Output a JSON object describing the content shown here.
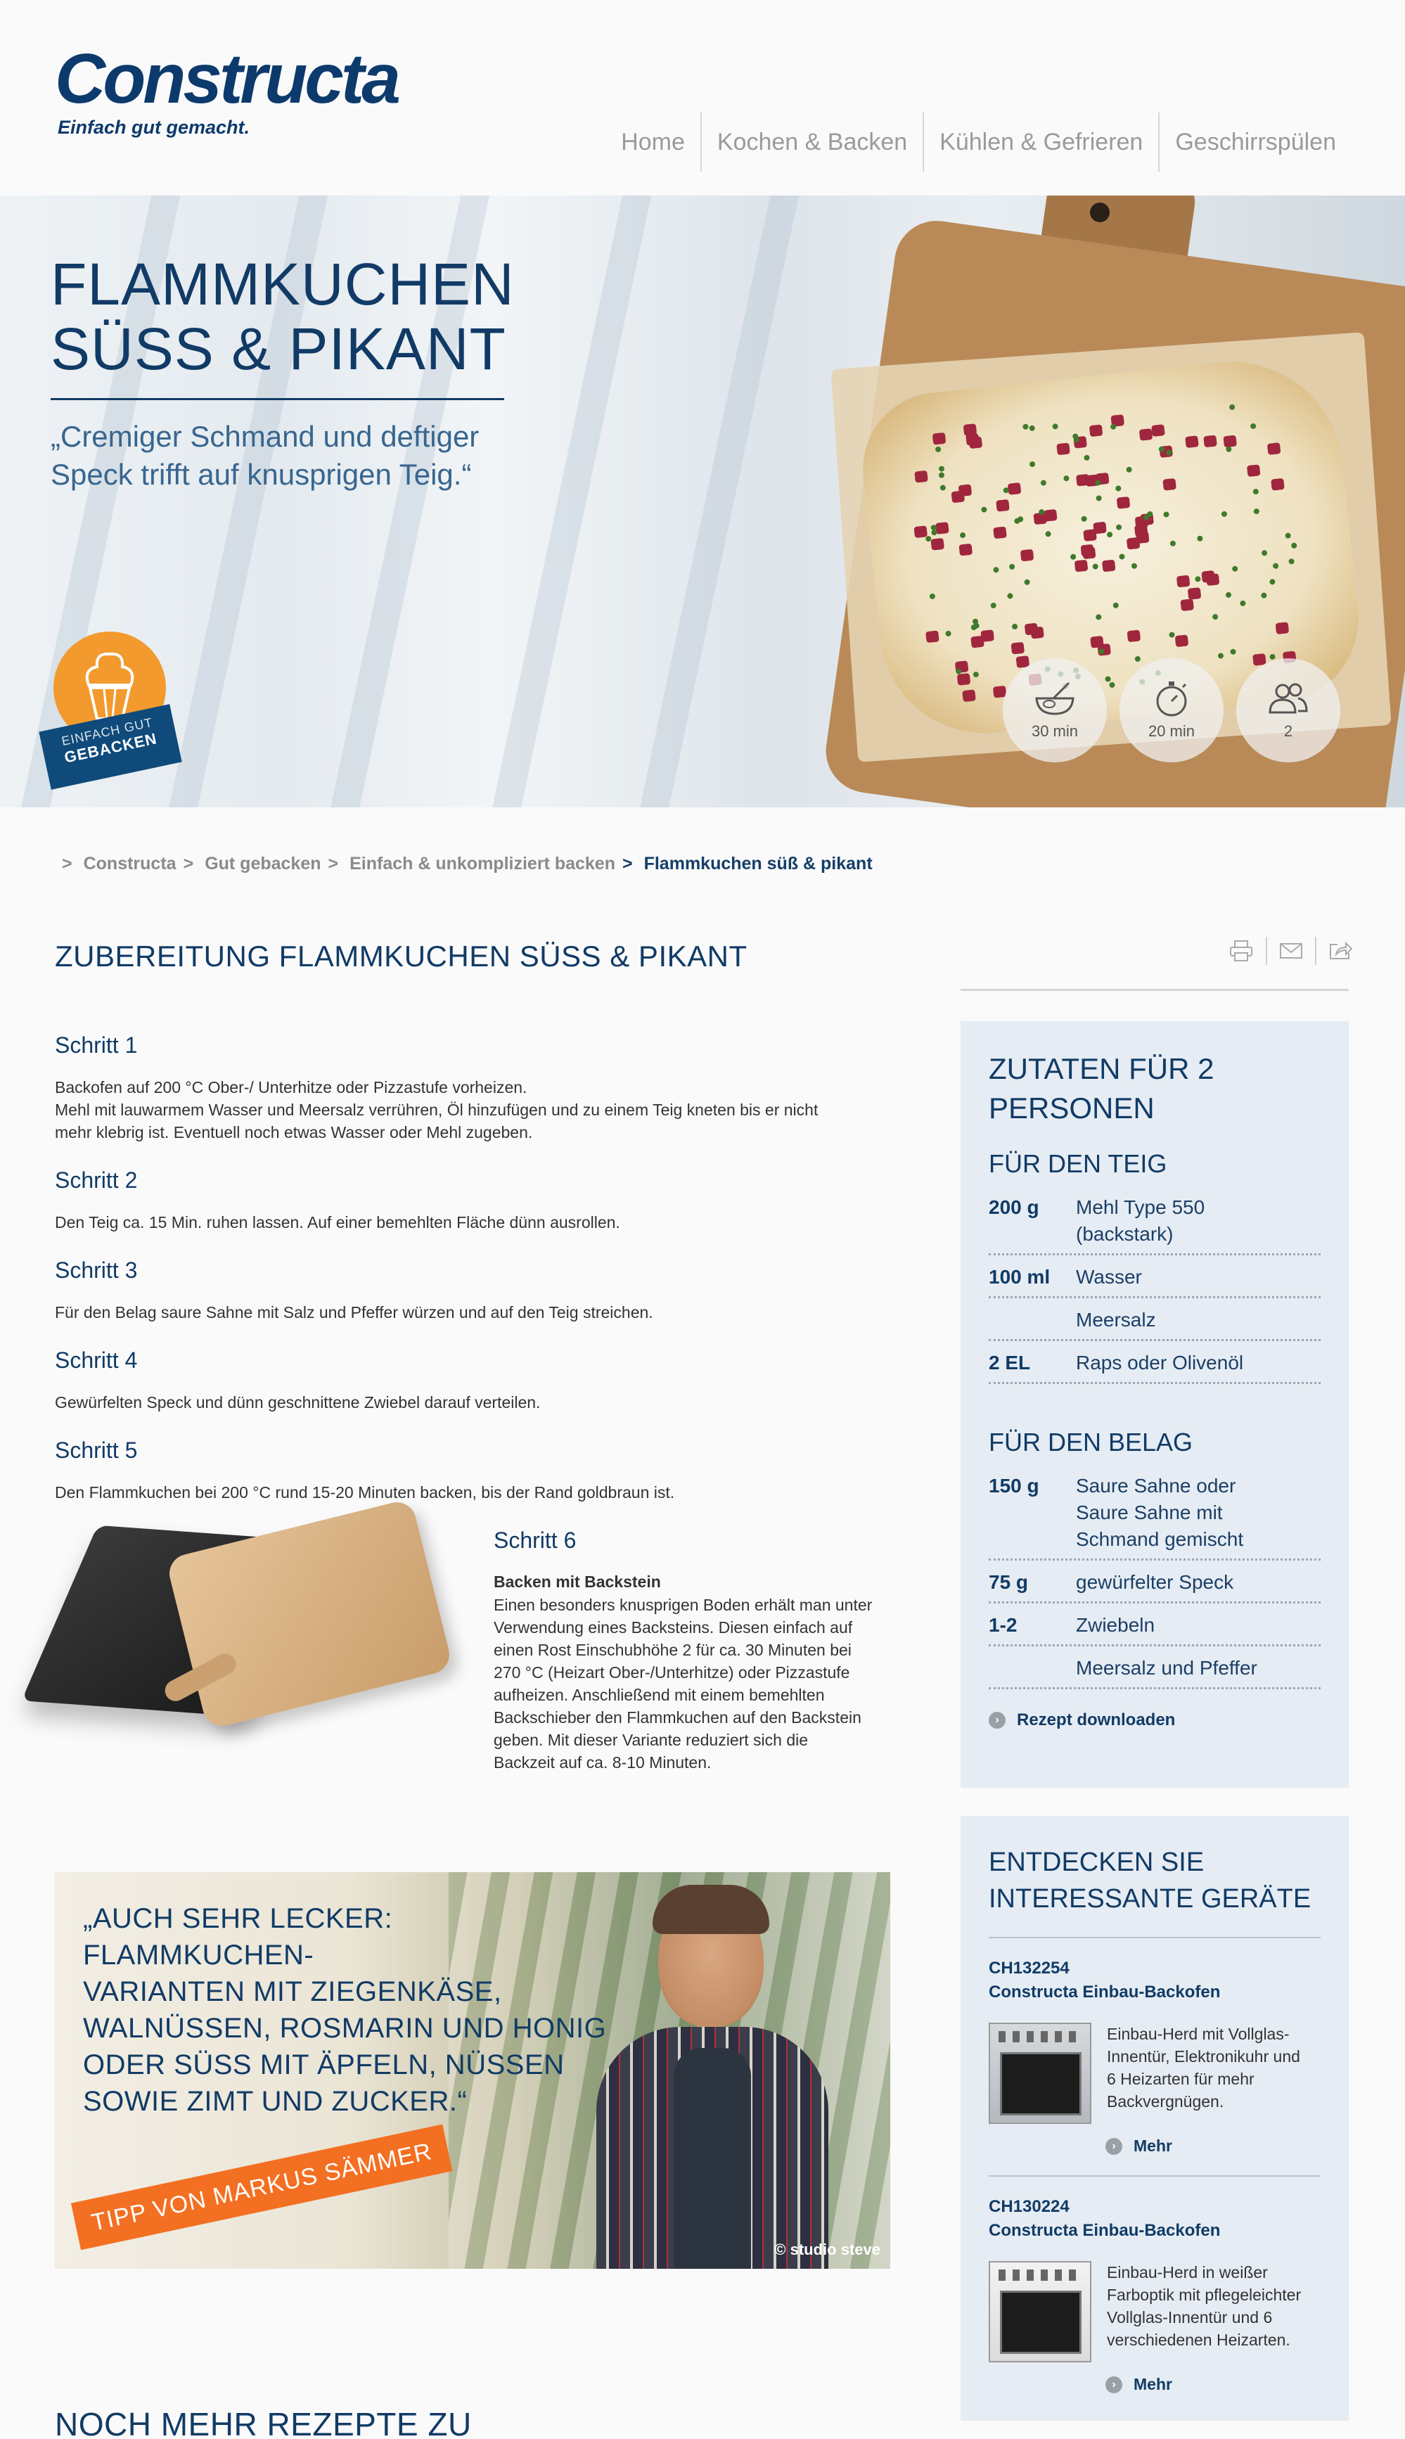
{
  "header": {
    "logo_word": "Constructa",
    "logo_tagline": "Einfach gut gemacht.",
    "nav": [
      "Home",
      "Kochen & Backen",
      "Kühlen & Gefrieren",
      "Geschirrspülen"
    ]
  },
  "hero": {
    "title_line1": "FLAMMKUCHEN",
    "title_line2": "SÜSS & PIKANT",
    "quote_line1": "„Cremiger Schmand und deftiger",
    "quote_line2": "Speck trifft auf knusprigen Teig.“",
    "badge_line1": "EINFACH GUT",
    "badge_line2": "GEBACKEN",
    "info": [
      {
        "icon": "bowl-whisk-icon",
        "label": "30 min"
      },
      {
        "icon": "stopwatch-icon",
        "label": "20 min"
      },
      {
        "icon": "people-icon",
        "label": "2"
      }
    ]
  },
  "breadcrumb": {
    "sep": ">",
    "items": [
      "Constructa",
      "Gut gebacken",
      "Einfach & unkompliziert backen"
    ],
    "current": "Flammkuchen süß & pikant"
  },
  "main": {
    "title": "ZUBEREITUNG FLAMMKUCHEN SÜSS & PIKANT",
    "steps": [
      {
        "title": "Schritt 1",
        "lines": [
          "Backofen auf 200 °C Ober-/ Unterhitze oder Pizzastufe vorheizen.",
          "Mehl mit lauwarmem Wasser und Meersalz verrühren, Öl hinzufügen und zu einem Teig kneten bis er nicht",
          "mehr klebrig ist. Eventuell noch etwas Wasser oder Mehl zugeben."
        ]
      },
      {
        "title": "Schritt 2",
        "lines": [
          "Den Teig ca. 15 Min. ruhen lassen. Auf einer bemehlten Fläche dünn ausrollen."
        ]
      },
      {
        "title": "Schritt 3",
        "lines": [
          "Für den Belag saure Sahne mit Salz und Pfeffer würzen und auf den Teig streichen."
        ]
      },
      {
        "title": "Schritt 4",
        "lines": [
          "Gewürfelten Speck und dünn geschnittene Zwiebel darauf verteilen."
        ]
      },
      {
        "title": "Schritt 5",
        "lines": [
          "Den Flammkuchen bei 200 °C rund 15-20 Minuten backen, bis der Rand goldbraun ist."
        ]
      }
    ],
    "step6": {
      "title": "Schritt 6",
      "subtitle": "Backen mit Backstein",
      "lines": [
        "Einen besonders knusprigen Boden erhält man unter",
        "Verwendung eines Backsteins. Diesen einfach auf",
        "einen Rost Einschubhöhe 2 für ca. 30 Minuten bei",
        "270 °C (Heizart Ober-/Unterhitze) oder Pizzastufe",
        "aufheizen. Anschließend mit einem bemehlten",
        "Backschieber den Flammkuchen auf den Backstein",
        "geben. Mit dieser Variante reduziert sich die",
        "Backzeit auf ca. 8-10 Minuten."
      ]
    },
    "tip": {
      "quote_lines": [
        "„AUCH SEHR LECKER: FLAMMKUCHEN-",
        "VARIANTEN MIT ZIEGENKÄSE,",
        "WALNÜSSEN, ROSMARIN UND HONIG",
        "ODER SÜSS MIT ÄPFELN, NÜSSEN",
        "SOWIE ZIMT UND ZUCKER.“"
      ],
      "ribbon": "TIPP VON MARKUS SÄMMER",
      "credit": "© studio steve"
    },
    "more_title": "NOCH MEHR REZEPTE ZU"
  },
  "ingredients": {
    "title_line1": "ZUTATEN FÜR 2",
    "title_line2": "PERSONEN",
    "groups": [
      {
        "title": "FÜR DEN TEIG",
        "items": [
          {
            "amount": "200 g",
            "name_lines": [
              "Mehl Type 550",
              "(backstark)"
            ]
          },
          {
            "amount": "100 ml",
            "name_lines": [
              "Wasser"
            ]
          },
          {
            "amount": "",
            "name_lines": [
              "Meersalz"
            ]
          },
          {
            "amount": "2 EL",
            "name_lines": [
              "Raps oder Olivenöl"
            ]
          }
        ]
      },
      {
        "title": "FÜR DEN BELAG",
        "items": [
          {
            "amount": "150 g",
            "name_lines": [
              "Saure Sahne oder",
              "Saure Sahne mit",
              "Schmand gemischt"
            ]
          },
          {
            "amount": "75 g",
            "name_lines": [
              "gewürfelter Speck"
            ]
          },
          {
            "amount": "1-2",
            "name_lines": [
              "Zwiebeln"
            ]
          },
          {
            "amount": "",
            "name_lines": [
              "Meersalz und Pfeffer"
            ]
          }
        ]
      }
    ],
    "download": "Rezept downloaden"
  },
  "devices": {
    "title_line1": "ENTDECKEN SIE",
    "title_line2": "INTERESSANTE GERÄTE",
    "items": [
      {
        "id": "CH132254",
        "name": "Constructa Einbau-Backofen",
        "desc_lines": [
          "Einbau-Herd mit Vollglas-",
          "Innentür, Elektronikuhr und",
          "6 Heizarten für mehr",
          "Backvergnügen."
        ],
        "more": "Mehr"
      },
      {
        "id": "CH130224",
        "name": "Constructa Einbau-Backofen",
        "desc_lines": [
          "Einbau-Herd in weißer",
          "Farboptik mit pflegeleichter",
          "Vollglas-Innentür und 6",
          "verschiedenen Heizarten."
        ],
        "more": "Mehr"
      }
    ]
  },
  "colors": {
    "brand_navy": "#113b66",
    "accent_orange": "#f36f21",
    "sidebar_bg": "#e6ecf3"
  }
}
